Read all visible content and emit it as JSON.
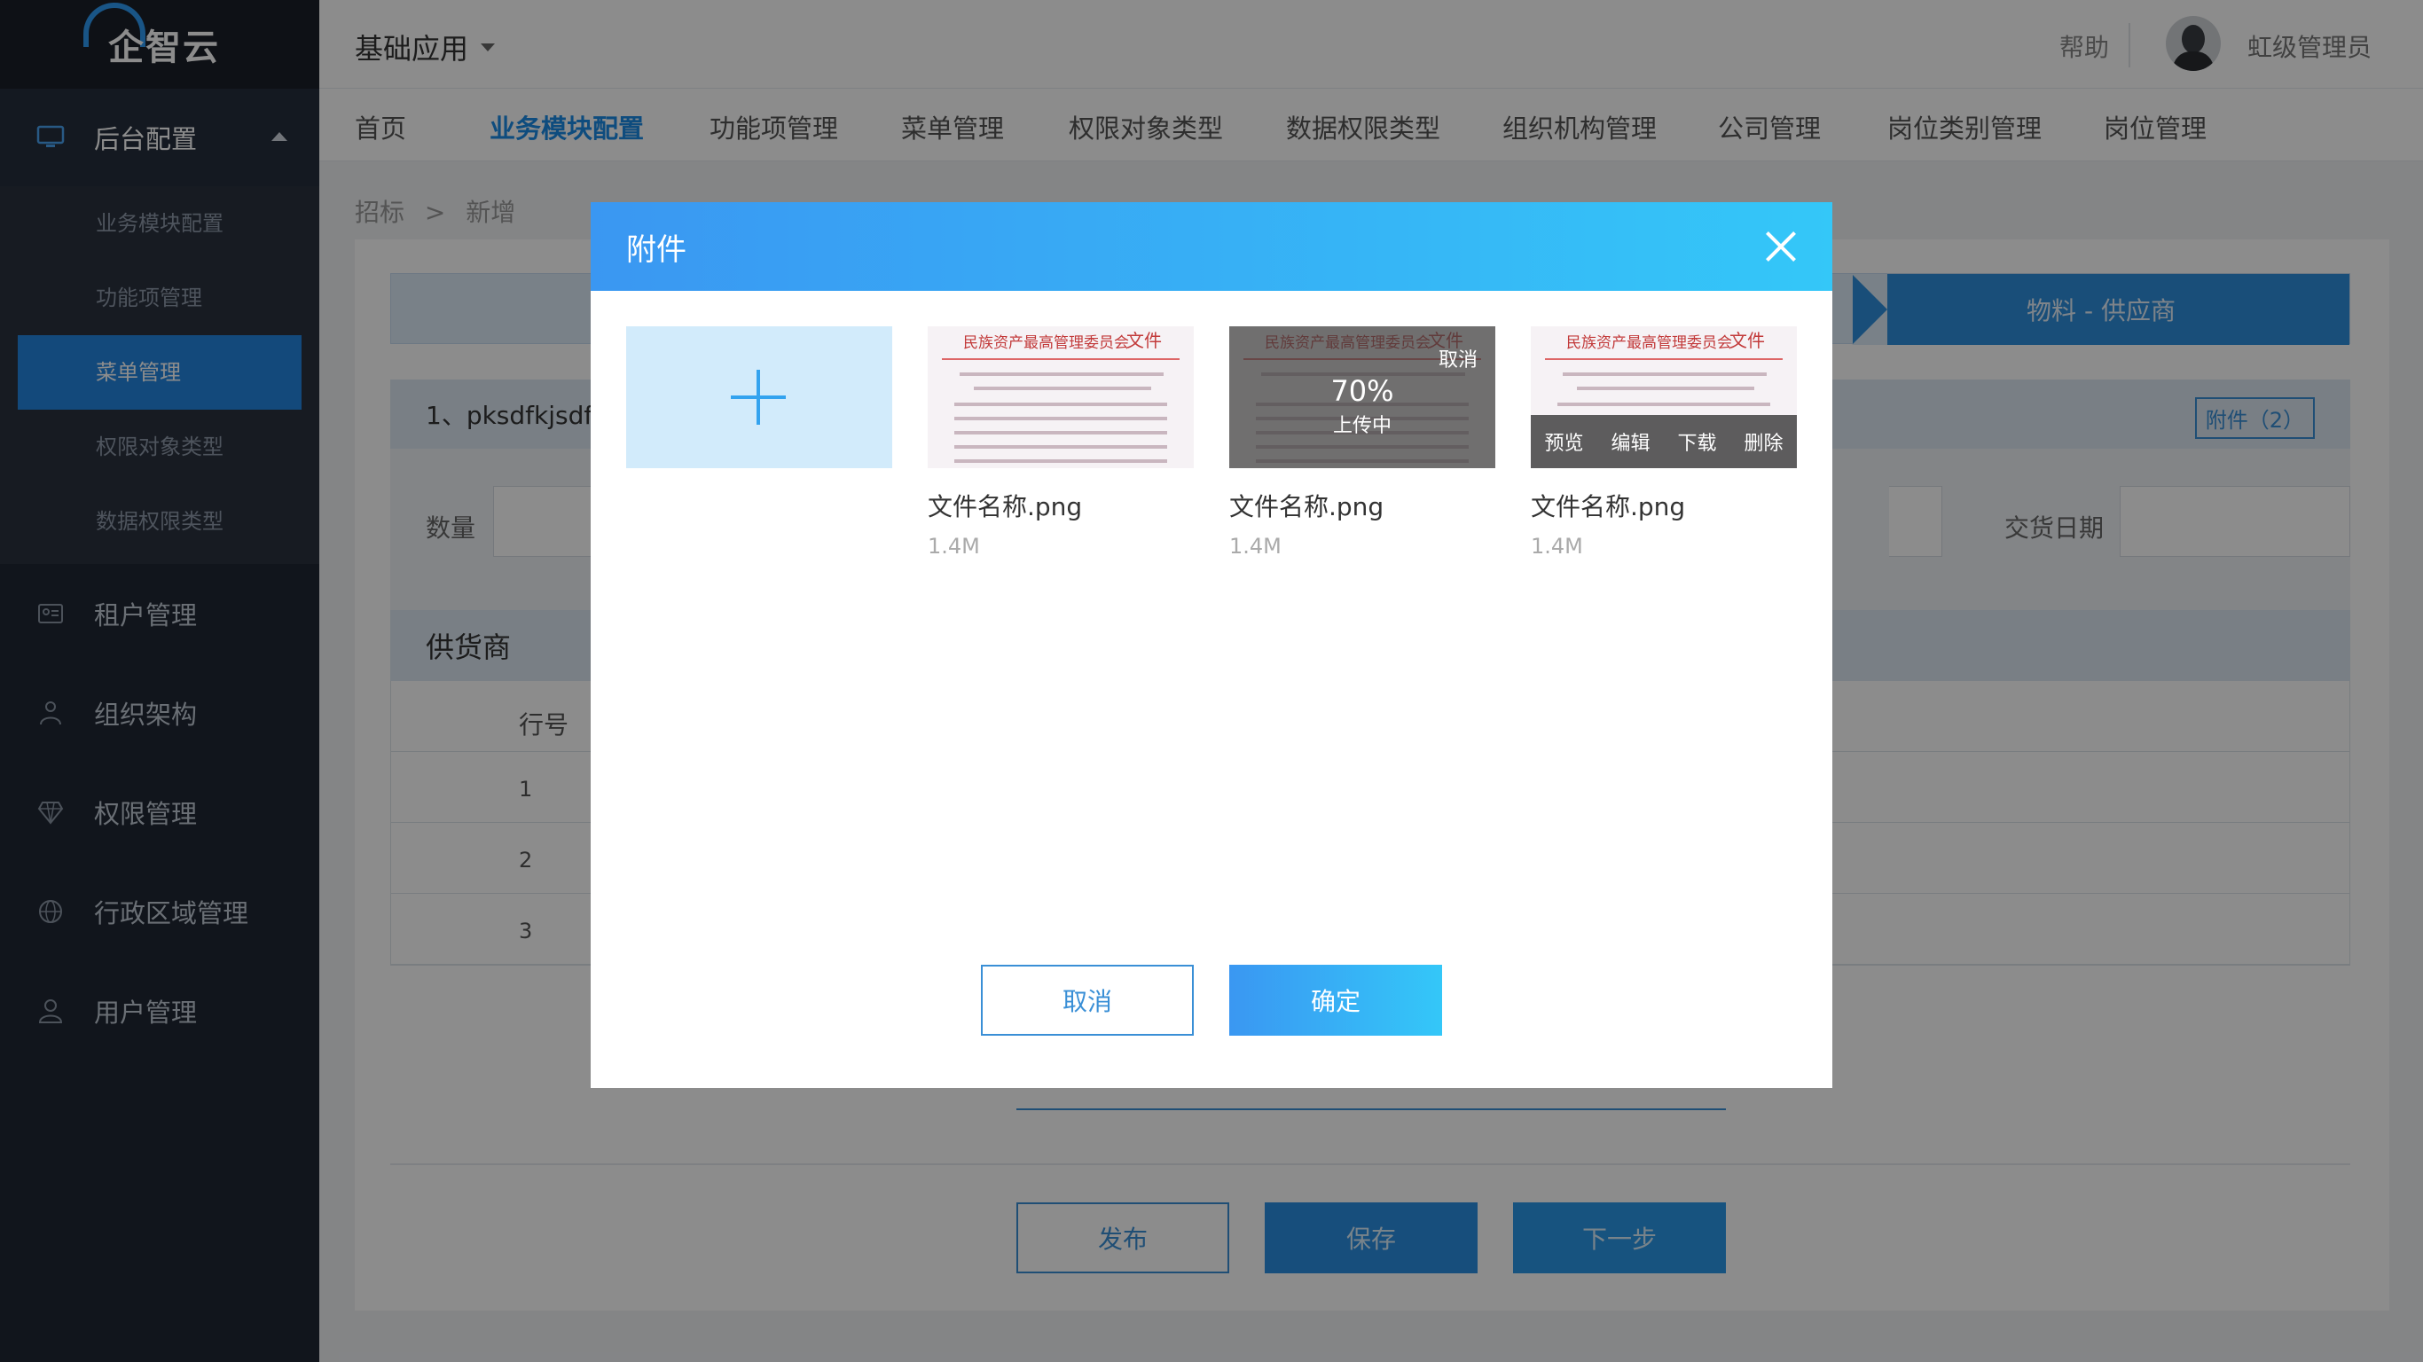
{
  "logo": {
    "text": "企智云"
  },
  "sidebar": {
    "group": {
      "label": "后台配置",
      "icon": "monitor-icon"
    },
    "subitems": [
      {
        "label": "业务模块配置"
      },
      {
        "label": "功能项管理"
      },
      {
        "label": "菜单管理",
        "active": true
      },
      {
        "label": "权限对象类型"
      },
      {
        "label": "数据权限类型"
      }
    ],
    "items": [
      {
        "label": "租户管理",
        "icon": "id-card-icon"
      },
      {
        "label": "组织架构",
        "icon": "org-icon"
      },
      {
        "label": "权限管理",
        "icon": "diamond-icon"
      },
      {
        "label": "行政区域管理",
        "icon": "globe-icon"
      },
      {
        "label": "用户管理",
        "icon": "user-icon"
      }
    ]
  },
  "topbar": {
    "app": "基础应用",
    "help": "帮助",
    "user": "虹级管理员"
  },
  "nav": {
    "tabs": [
      {
        "label": "首页"
      },
      {
        "label": "业务模块配置",
        "active": true
      },
      {
        "label": "功能项管理"
      },
      {
        "label": "菜单管理"
      },
      {
        "label": "权限对象类型"
      },
      {
        "label": "数据权限类型"
      },
      {
        "label": "组织机构管理"
      },
      {
        "label": "公司管理"
      },
      {
        "label": "岗位类别管理"
      },
      {
        "label": "岗位管理"
      }
    ]
  },
  "breadcrumb": {
    "a": "招标",
    "sep": ">",
    "b": "新增"
  },
  "steps": {
    "right": "物料 - 供应商"
  },
  "section": {
    "title": "1、pksdfkjsdf",
    "attach": "附件（2）",
    "qty_label": "数量",
    "date_label": "交货日期"
  },
  "supplier": {
    "title": "供货商",
    "col": "行号",
    "rows": [
      "1",
      "2",
      "3"
    ]
  },
  "bottom": {
    "publish": "发布",
    "save": "保存",
    "next": "下一步"
  },
  "modal": {
    "title": "附件",
    "doc_header": "民族资产最高管理委员会",
    "doc_tag": "文件",
    "files": [
      {
        "name": "文件名称.png",
        "size": "1.4M"
      },
      {
        "name": "文件名称.png",
        "size": "1.4M",
        "progress": "70%",
        "status": "上传中",
        "cancel": "取消"
      },
      {
        "name": "文件名称.png",
        "size": "1.4M",
        "actions": [
          "预览",
          "编辑",
          "下载",
          "删除"
        ]
      }
    ],
    "cancel": "取消",
    "ok": "确定"
  },
  "colors": {
    "accent": "#2486e0",
    "sidebar": "#1f2733",
    "modal_gradient_start": "#3a97f2",
    "modal_gradient_end": "#34c7f8"
  }
}
